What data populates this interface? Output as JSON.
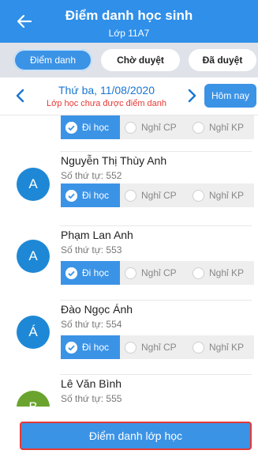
{
  "header": {
    "title": "Điểm danh học sinh",
    "subtitle": "Lớp 11A7"
  },
  "tabs": [
    {
      "label": "Điểm danh",
      "active": true
    },
    {
      "label": "Chờ duyệt",
      "active": false
    },
    {
      "label": "Đã duyệt",
      "active": false
    }
  ],
  "date": {
    "label": "Thứ ba, 11/08/2020",
    "status": "Lớp học chưa được điểm danh",
    "today_label": "Hôm nay"
  },
  "options": {
    "present": "Đi học",
    "excused": "Nghỉ CP",
    "unexcused": "Nghỉ KP"
  },
  "students": [
    {
      "initial": "",
      "name": "",
      "stt": ""
    },
    {
      "initial": "A",
      "name": "Nguyễn Thị Thùy Anh",
      "stt": "Số thứ tự: 552"
    },
    {
      "initial": "A",
      "name": "Phạm Lan Anh",
      "stt": "Số thứ tự: 553"
    },
    {
      "initial": "Á",
      "name": "Đào Ngọc Ánh",
      "stt": "Số thứ tự: 554"
    },
    {
      "initial": "B",
      "name": "Lê Văn Bình",
      "stt": "Số thứ tự: 555"
    }
  ],
  "footer": {
    "button_label": "Điểm danh lớp học"
  },
  "colors": {
    "primary": "#2f8fe9",
    "button": "#3b93e6",
    "status_red": "#e53935",
    "avatar_green": "#6aa42e"
  }
}
